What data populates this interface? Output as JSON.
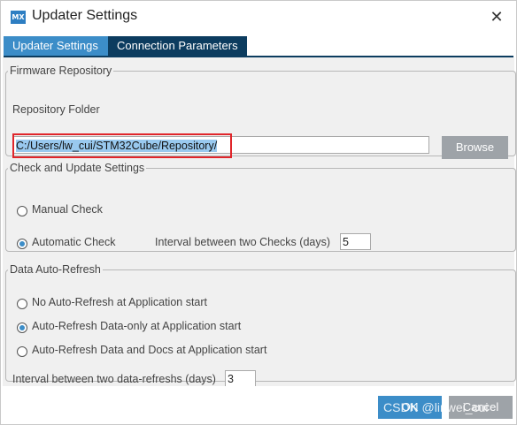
{
  "window": {
    "title": "Updater Settings",
    "app_icon_text": "MX",
    "close_symbol": "✕"
  },
  "tabs": [
    {
      "label": "Updater Settings",
      "active": true
    },
    {
      "label": "Connection Parameters",
      "active": false
    }
  ],
  "firmware_repository": {
    "legend": "Firmware Repository",
    "folder_label": "Repository Folder",
    "folder_value": "C:/Users/lw_cui/STM32Cube/Repository/",
    "browse_label": "Browse"
  },
  "check_update": {
    "legend": "Check and Update Settings",
    "options": [
      {
        "label": "Manual Check",
        "selected": false
      },
      {
        "label": "Automatic Check",
        "selected": true
      }
    ],
    "interval_label": "Interval between two Checks (days)",
    "interval_value": "5"
  },
  "auto_refresh": {
    "legend": "Data Auto-Refresh",
    "options": [
      {
        "label": "No Auto-Refresh at Application start",
        "selected": false
      },
      {
        "label": "Auto-Refresh Data-only at Application start",
        "selected": true
      },
      {
        "label": "Auto-Refresh Data and Docs at Application start",
        "selected": false
      }
    ],
    "interval_label": "Interval between two data-refreshs (days)",
    "interval_value": "3"
  },
  "footer": {
    "ok_label": "OK",
    "cancel_label": "Cancel",
    "watermark": "CSDN @linwei_cui"
  },
  "colors": {
    "accent": "#3c8dc8",
    "tab_dark": "#0c3c5f",
    "highlight_box": "#e0262b",
    "button_gray": "#9ea3a8"
  }
}
